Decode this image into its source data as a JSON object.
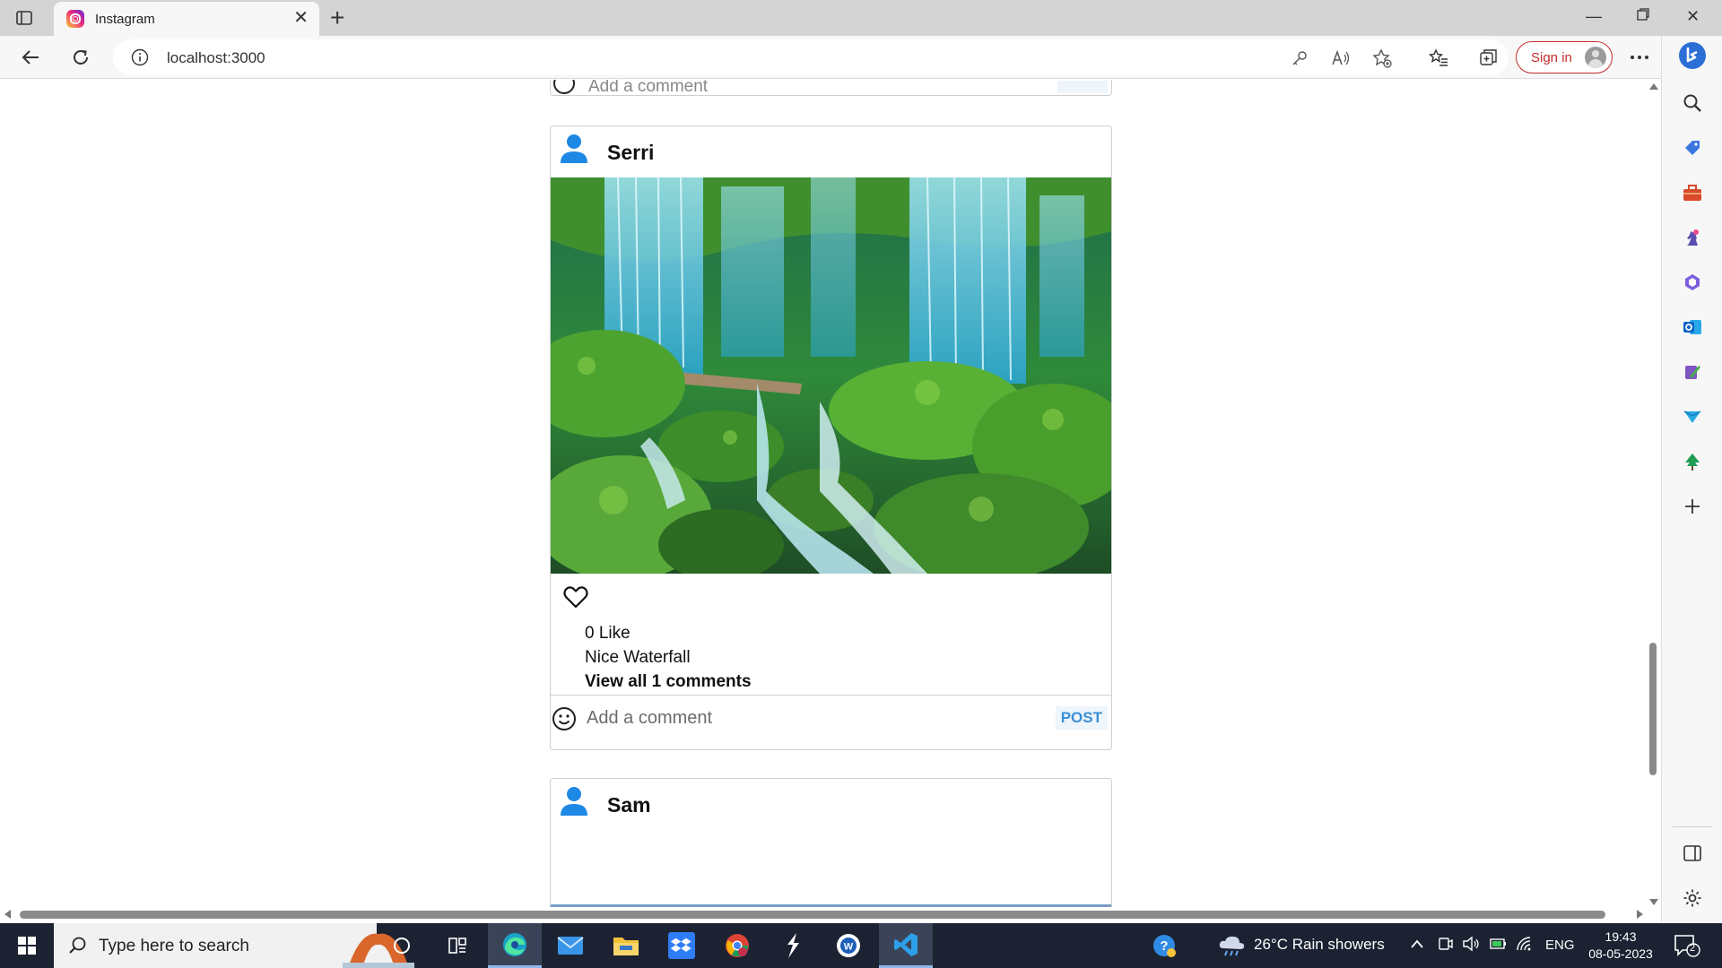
{
  "browser": {
    "tab_title": "Instagram",
    "url": "localhost:3000",
    "sign_in_label": "Sign in"
  },
  "previous_post": {
    "comment_placeholder": "Add a comment"
  },
  "posts": [
    {
      "username": "Serri",
      "likes_text": "0 Like",
      "caption": "Nice Waterfall",
      "view_comments": "View all 1 comments",
      "comment_placeholder": "Add a comment",
      "post_label": "POST"
    },
    {
      "username": "Sam"
    }
  ],
  "taskbar": {
    "search_placeholder": "Type here to search",
    "weather": "26°C  Rain showers",
    "language": "ENG",
    "time": "19:43",
    "date": "08-05-2023",
    "notifications": "2"
  },
  "colors": {
    "accent_blue": "#3b8fd6",
    "sign_in_red": "#c42b2b",
    "taskbar_bg": "#1c2232",
    "card_border": "#cfcfcf"
  }
}
